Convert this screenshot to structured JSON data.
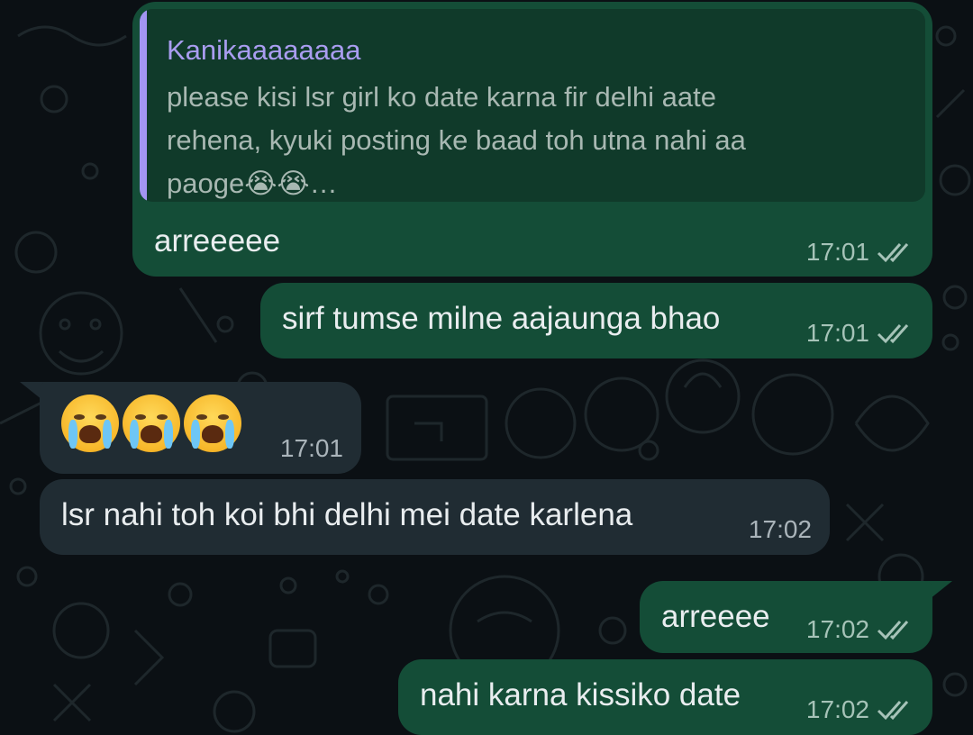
{
  "messages": [
    {
      "direction": "outgoing",
      "reply_to": {
        "author": "Kanikaaaaaaaa",
        "text": "please kisi lsr girl ko date karna fir delhi aate\nrehena, kyuki posting ke baad toh utna nahi aa\npaoge😭😭…"
      },
      "text": "arreeeee",
      "time": "17:01",
      "status": "read"
    },
    {
      "direction": "outgoing",
      "text": "sirf tumse milne aajaunga bhao",
      "time": "17:01",
      "status": "read"
    },
    {
      "direction": "incoming",
      "text": "😭😭😭",
      "time": "17:01"
    },
    {
      "direction": "incoming",
      "text": "lsr nahi toh koi bhi delhi mei date karlena",
      "time": "17:02"
    },
    {
      "direction": "outgoing",
      "text": "arreeee",
      "time": "17:02",
      "status": "read"
    },
    {
      "direction": "outgoing",
      "text": "nahi karna kissiko date",
      "time": "17:02",
      "status": "read"
    }
  ],
  "colors": {
    "background": "#0b1014",
    "outgoing_bubble": "#144d37",
    "incoming_bubble": "#202c33",
    "quote_bar": "#a395f2",
    "read_ticks": "#a6c3b8"
  },
  "icons": {
    "read_receipt": "double-check-icon",
    "crying_emoji": "loudly-crying-face-icon"
  }
}
